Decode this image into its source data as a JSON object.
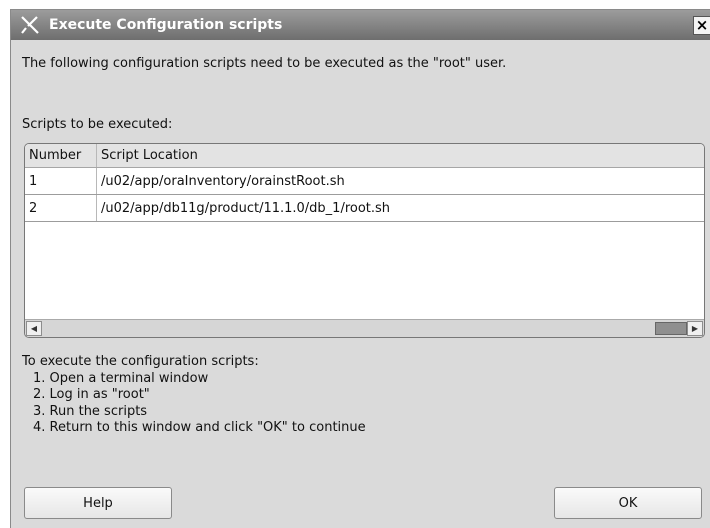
{
  "window": {
    "title": "Execute Configuration scripts",
    "close_glyph": "×"
  },
  "intro_text": "The following configuration scripts need to be executed as the \"root\" user.",
  "scripts_label": "Scripts to be executed:",
  "table": {
    "columns": [
      "Number",
      "Script Location"
    ],
    "rows": [
      {
        "number": "1",
        "location": "/u02/app/oraInventory/orainstRoot.sh"
      },
      {
        "number": "2",
        "location": "/u02/app/db11g/product/11.1.0/db_1/root.sh"
      }
    ]
  },
  "instructions": {
    "heading": "To execute the configuration scripts:",
    "steps": [
      "1. Open a terminal window",
      "2. Log in as \"root\"",
      "3. Run the scripts",
      "4. Return to this window and click \"OK\" to continue"
    ]
  },
  "buttons": {
    "help_label": "Help",
    "ok_label": "OK"
  },
  "icons": {
    "app": "oracle-installer-x-icon",
    "close": "close-icon",
    "scroll_left": "scroll-left-arrow-icon",
    "scroll_right": "scroll-right-arrow-icon"
  }
}
